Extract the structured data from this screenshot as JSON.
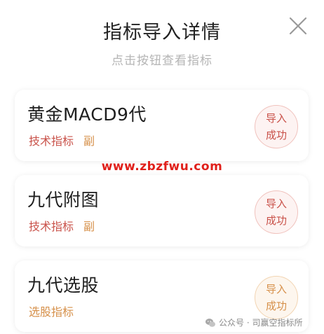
{
  "header": {
    "title": "指标导入详情",
    "subtitle": "点击按钮查看指标"
  },
  "icons": {
    "close": "close-icon",
    "wechat": "wechat-icon"
  },
  "colors": {
    "tag_red": "#c9524a",
    "tag_orange": "#d6904a",
    "watermark": "#e0201b"
  },
  "cards": [
    {
      "name": "黄金MACD9代",
      "tags": [
        "技术指标",
        "副"
      ],
      "status": [
        "导入",
        "成功"
      ]
    },
    {
      "name": "九代附图",
      "tags": [
        "技术指标",
        "副"
      ],
      "status": [
        "导入",
        "成功"
      ]
    },
    {
      "name": "九代选股",
      "tags": [
        "选股指标"
      ],
      "status": [
        "导入",
        "成功"
      ]
    }
  ],
  "watermark": "www.zbzfwu.com",
  "footer": {
    "text": "公众号 · 司赢空指标所"
  }
}
